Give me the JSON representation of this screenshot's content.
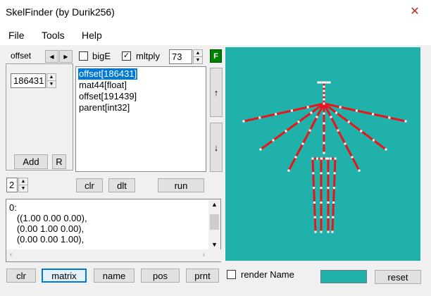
{
  "window": {
    "title": "SkelFinder (by Durik256)",
    "close_glyph": "✕",
    "close_color": "#c42b1c"
  },
  "menu": [
    {
      "label": "File"
    },
    {
      "label": "Tools"
    },
    {
      "label": "Help"
    }
  ],
  "type_panel": {
    "tab_label": "offset",
    "value": "186431",
    "add_label": "Add",
    "r_label": "R"
  },
  "options": {
    "bigE_label": "bigE",
    "bigE_checked": false,
    "mltply_label": "mltply",
    "mltply_checked": true,
    "count_value": "73",
    "f_label": "F",
    "f_color": "#008000"
  },
  "struct_list": {
    "items": [
      "offset[186431]",
      "mat44[float]",
      "offset[191439]",
      "parent[int32]"
    ],
    "selected_index": 0
  },
  "side_buttons": {
    "up": "↑",
    "down": "↓"
  },
  "level_value": "2",
  "actions": {
    "clr": "clr",
    "dlt": "dlt",
    "run": "run"
  },
  "output": {
    "lines": [
      "0:",
      "   ((1.00 0.00 0.00),",
      "   (0.00 1.00 0.00),",
      "   (0.00 0.00 1.00),"
    ]
  },
  "bottom_bar": {
    "clr": "clr",
    "matrix": "matrix",
    "name": "name",
    "pos": "pos",
    "prnt": "prnt",
    "render_name_label": "render Name",
    "render_name_checked": false,
    "reset": "reset"
  },
  "viewport": {
    "background": "#20b2aa",
    "bone_color": "#e8151b",
    "joint_color": "#ffffff"
  },
  "bg_color": "#20b2aa"
}
